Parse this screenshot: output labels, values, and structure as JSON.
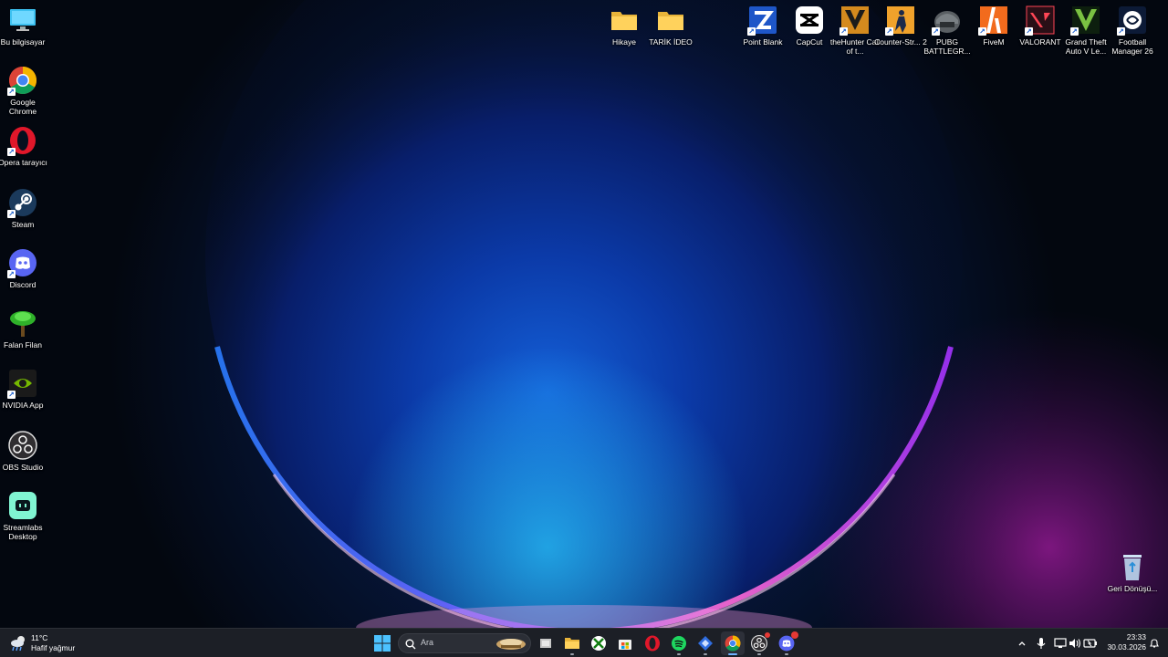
{
  "desktop_left": [
    {
      "name": "this-pc",
      "label": "Bu bilgisayar",
      "icon": "monitor-icon"
    },
    {
      "name": "google-chrome",
      "label": "Google Chrome",
      "icon": "chrome-icon"
    },
    {
      "name": "opera",
      "label": "Opera tarayıcı",
      "icon": "opera-icon"
    },
    {
      "name": "steam",
      "label": "Steam",
      "icon": "steam-icon"
    },
    {
      "name": "discord",
      "label": "Discord",
      "icon": "discord-icon"
    },
    {
      "name": "falan-filan",
      "label": "Falan Filan",
      "icon": "tree-icon"
    },
    {
      "name": "nvidia-app",
      "label": "NVIDIA App",
      "icon": "nvidia-icon"
    },
    {
      "name": "obs-studio",
      "label": "OBS Studio",
      "icon": "obs-icon"
    },
    {
      "name": "streamlabs",
      "label": "Streamlabs Desktop",
      "icon": "streamlabs-icon"
    }
  ],
  "desktop_top": [
    {
      "name": "hikaye-folder",
      "label": "Hikaye",
      "icon": "folder-icon"
    },
    {
      "name": "tarik-ideo-folder",
      "label": "TARİK İDEO",
      "icon": "folder-icon"
    },
    {
      "name": "point-blank",
      "label": "Point Blank",
      "icon": "point-blank-icon"
    },
    {
      "name": "capcut",
      "label": "CapCut",
      "icon": "capcut-icon"
    },
    {
      "name": "thehunter",
      "label": "theHunter Call of t...",
      "icon": "thehunter-icon"
    },
    {
      "name": "counter-strike",
      "label": "Counter-Str... 2",
      "icon": "counter-strike-icon"
    },
    {
      "name": "pubg",
      "label": "PUBG BATTLEGR...",
      "icon": "pubg-icon"
    },
    {
      "name": "fivem",
      "label": "FiveM",
      "icon": "fivem-icon"
    },
    {
      "name": "valorant",
      "label": "VALORANT",
      "icon": "valorant-icon"
    },
    {
      "name": "gta-v",
      "label": "Grand Theft Auto V Le...",
      "icon": "gta-icon"
    },
    {
      "name": "football-manager",
      "label": "Football Manager 26",
      "icon": "football-manager-icon"
    }
  ],
  "recycle_bin": {
    "label": "Geri Dönüşü...",
    "icon": "recycle-bin-icon"
  },
  "taskbar": {
    "weather_temp": "11°C",
    "weather_desc": "Hafif yağmur",
    "search_placeholder": "Ara",
    "clock_time": "23:33",
    "clock_date": "30.03.2026",
    "apps": [
      {
        "name": "start",
        "icon": "windows-logo-icon"
      },
      {
        "name": "search",
        "icon": "search-icon"
      },
      {
        "name": "task-view",
        "icon": "task-view-icon"
      },
      {
        "name": "file-explorer",
        "icon": "folder-icon"
      },
      {
        "name": "xbox",
        "icon": "xbox-icon"
      },
      {
        "name": "ms-store",
        "icon": "store-icon"
      },
      {
        "name": "opera",
        "icon": "opera-icon"
      },
      {
        "name": "spotify",
        "icon": "spotify-icon"
      },
      {
        "name": "app-blue",
        "icon": "app-icon"
      },
      {
        "name": "chrome",
        "icon": "chrome-icon"
      },
      {
        "name": "obs",
        "icon": "obs-icon"
      },
      {
        "name": "discord",
        "icon": "discord-icon"
      }
    ]
  }
}
